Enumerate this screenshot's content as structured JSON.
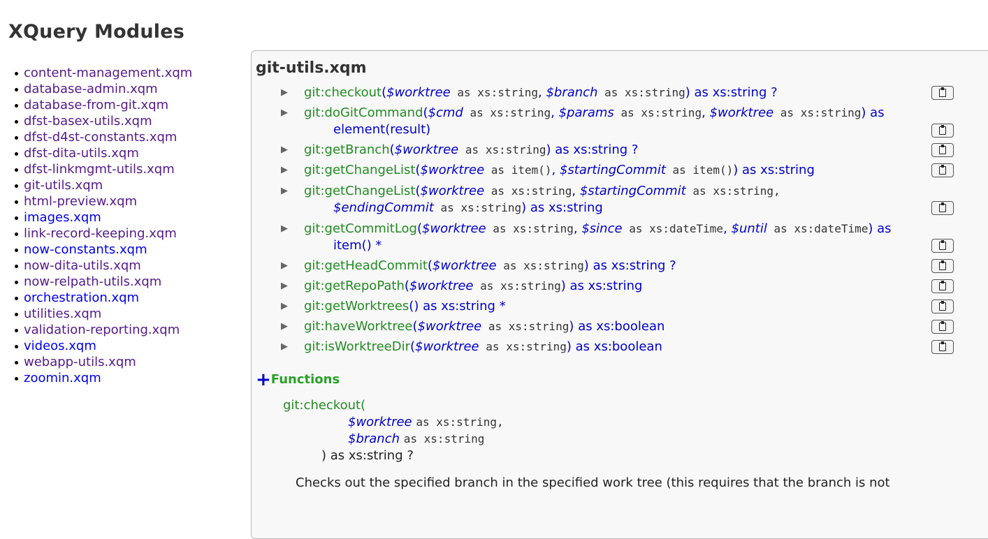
{
  "page_title": "XQuery Modules",
  "modules": [
    {
      "label": "content-management.xqm",
      "visited": true
    },
    {
      "label": "database-admin.xqm",
      "visited": true
    },
    {
      "label": "database-from-git.xqm",
      "visited": true
    },
    {
      "label": "dfst-basex-utils.xqm",
      "visited": true
    },
    {
      "label": "dfst-d4st-constants.xqm",
      "visited": true
    },
    {
      "label": "dfst-dita-utils.xqm",
      "visited": true
    },
    {
      "label": "dfst-linkmgmt-utils.xqm",
      "visited": true
    },
    {
      "label": "git-utils.xqm",
      "visited": true
    },
    {
      "label": "html-preview.xqm",
      "visited": true
    },
    {
      "label": "images.xqm",
      "visited": false
    },
    {
      "label": "link-record-keeping.xqm",
      "visited": true
    },
    {
      "label": "now-constants.xqm",
      "visited": false
    },
    {
      "label": "now-dita-utils.xqm",
      "visited": true
    },
    {
      "label": "now-relpath-utils.xqm",
      "visited": true
    },
    {
      "label": "orchestration.xqm",
      "visited": false
    },
    {
      "label": "utilities.xqm",
      "visited": true
    },
    {
      "label": "validation-reporting.xqm",
      "visited": true
    },
    {
      "label": "videos.xqm",
      "visited": false
    },
    {
      "label": "webapp-utils.xqm",
      "visited": true
    },
    {
      "label": "zoomin.xqm",
      "visited": false
    }
  ],
  "module_name": "git-utils.xqm",
  "keyword_as": "as",
  "signatures": [
    {
      "fn": "git:checkout",
      "l1": [
        [
          "p",
          "$worktree"
        ],
        [
          "t",
          "xs:string"
        ],
        [
          "c",
          ", "
        ],
        [
          "p",
          "$branch"
        ],
        [
          "t",
          "xs:string"
        ],
        [
          "c",
          ")"
        ]
      ],
      "ret1": "as xs:string ?",
      "l2": null,
      "ret2": null
    },
    {
      "fn": "git:doGitCommand",
      "l1": [
        [
          "p",
          "$cmd"
        ],
        [
          "t",
          "xs:string"
        ],
        [
          "c",
          ", "
        ],
        [
          "p",
          "$params"
        ],
        [
          "t",
          "xs:string"
        ],
        [
          "c",
          ", "
        ],
        [
          "p",
          "$worktree"
        ],
        [
          "t",
          "xs:string"
        ],
        [
          "c",
          ")"
        ]
      ],
      "ret1": "as",
      "l2": "element(result)",
      "ret2": null
    },
    {
      "fn": "git:getBranch",
      "l1": [
        [
          "p",
          "$worktree"
        ],
        [
          "t",
          "xs:string"
        ],
        [
          "c",
          ")"
        ]
      ],
      "ret1": "as xs:string ?",
      "l2": null,
      "ret2": null
    },
    {
      "fn": "git:getChangeList",
      "l1": [
        [
          "p",
          "$worktree"
        ],
        [
          "t",
          "item()"
        ],
        [
          "c",
          ", "
        ],
        [
          "p",
          "$startingCommit"
        ],
        [
          "t",
          "item()"
        ],
        [
          "c",
          ")"
        ]
      ],
      "ret1": "as xs:string",
      "l2": null,
      "ret2": null
    },
    {
      "fn": "git:getChangeList",
      "l1": [
        [
          "p",
          "$worktree"
        ],
        [
          "t",
          "xs:string"
        ],
        [
          "c",
          ", "
        ],
        [
          "p",
          "$startingCommit"
        ],
        [
          "t",
          "xs:string,"
        ]
      ],
      "ret1": "",
      "l2p": "$endingCommit",
      "l2t": "xs:string",
      "l2": ") as xs:string",
      "ret2": null
    },
    {
      "fn": "git:getCommitLog",
      "l1": [
        [
          "p",
          "$worktree"
        ],
        [
          "t",
          "xs:string"
        ],
        [
          "c",
          ", "
        ],
        [
          "p",
          "$since"
        ],
        [
          "t",
          "xs:dateTime"
        ],
        [
          "c",
          ", "
        ],
        [
          "p",
          "$until"
        ],
        [
          "t",
          "xs:dateTime"
        ],
        [
          "c",
          ")"
        ]
      ],
      "ret1": "as",
      "l2": "item() *",
      "ret2": null
    },
    {
      "fn": "git:getHeadCommit",
      "l1": [
        [
          "p",
          "$worktree"
        ],
        [
          "t",
          "xs:string"
        ],
        [
          "c",
          ")"
        ]
      ],
      "ret1": "as xs:string ?",
      "l2": null,
      "ret2": null
    },
    {
      "fn": "git:getRepoPath",
      "l1": [
        [
          "p",
          "$worktree"
        ],
        [
          "t",
          "xs:string"
        ],
        [
          "c",
          ")"
        ]
      ],
      "ret1": "as xs:string",
      "l2": null,
      "ret2": null
    },
    {
      "fn": "git:getWorktrees",
      "l1": [
        [
          "c",
          ")"
        ]
      ],
      "ret1": "as xs:string *",
      "l2": null,
      "ret2": null
    },
    {
      "fn": "git:haveWorktree",
      "l1": [
        [
          "p",
          "$worktree"
        ],
        [
          "t",
          "xs:string"
        ],
        [
          "c",
          ")"
        ]
      ],
      "ret1": "as xs:boolean",
      "l2": null,
      "ret2": null
    },
    {
      "fn": "git:isWorktreeDir",
      "l1": [
        [
          "p",
          "$worktree"
        ],
        [
          "t",
          "xs:string"
        ],
        [
          "c",
          ")"
        ]
      ],
      "ret1": "as xs:boolean",
      "l2": null,
      "ret2": null
    }
  ],
  "functions_heading": "Functions",
  "functions_plus": "+",
  "detail": {
    "fn_open": "git:checkout(",
    "param1_name": "$worktree",
    "param1_type": "as xs:string,",
    "param2_name": "$branch",
    "param2_type": "as xs:string",
    "close_ret": ") as xs:string ?",
    "description": "Checks out the specified branch in the specified work tree (this requires that the branch is not"
  }
}
